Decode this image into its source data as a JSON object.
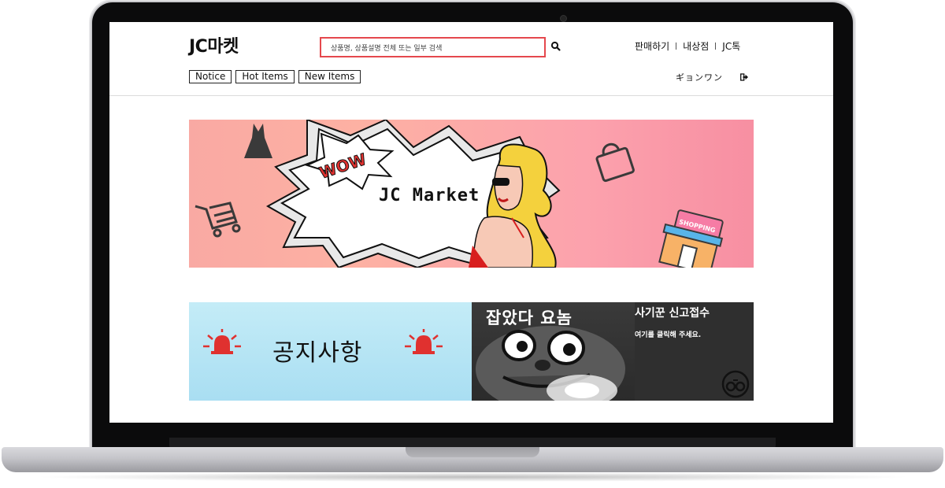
{
  "header": {
    "logo": "JC마켓",
    "search": {
      "placeholder": "상품명, 상품설명 전체 또는 일부 검색"
    },
    "links": [
      "판매하기",
      "내상점",
      "JC톡"
    ],
    "tabs": [
      "Notice",
      "Hot Items",
      "New Items"
    ],
    "user_name": "ギョンワン"
  },
  "hero_banner": {
    "title": "JC Market",
    "burst_text": "WOW",
    "shop_sign": "SHOPPING"
  },
  "notice_banner": {
    "label": "공지사항"
  },
  "scam_banner": {
    "headline": "잡았다 요놈"
  },
  "report_banner": {
    "title": "사기꾼 신고접수",
    "subtitle": "여기를 클릭해 주세요."
  },
  "colors": {
    "search_border": "#e5484d",
    "notice_bg": "#b8e6f5",
    "hero_pink": "#fca2ad",
    "siren_red": "#e0312f"
  },
  "icons": [
    "search-icon",
    "logout-icon",
    "dress-icon",
    "shopping-bag-icon",
    "cart-icon",
    "shop-icon",
    "siren-icon",
    "handcuffs-icon"
  ]
}
